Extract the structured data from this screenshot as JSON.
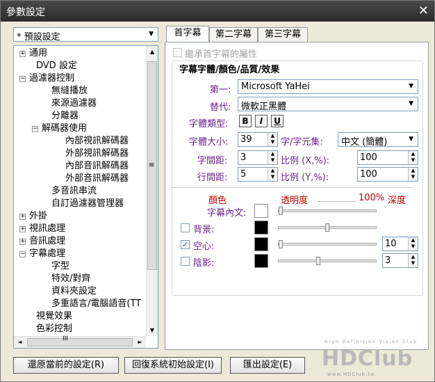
{
  "window": {
    "title": "參數設定",
    "close_glyph": "✕"
  },
  "preset": {
    "value": "* 預設設定"
  },
  "tree": [
    {
      "label": "通用",
      "expander": "+"
    },
    {
      "label": "DVD 設定",
      "expander": ""
    },
    {
      "label": "過濾器控制",
      "expander": "−"
    },
    {
      "label": "無縫播放",
      "expander": ""
    },
    {
      "label": "來源過濾器",
      "expander": ""
    },
    {
      "label": "分離器",
      "expander": ""
    },
    {
      "label": "解碼器使用",
      "expander": "−"
    },
    {
      "label": "內部視訊解碼器",
      "expander": ""
    },
    {
      "label": "外部視訊解碼器",
      "expander": ""
    },
    {
      "label": "內部音訊解碼器",
      "expander": ""
    },
    {
      "label": "外部音訊解碼器",
      "expander": ""
    },
    {
      "label": "多音訊串流",
      "expander": ""
    },
    {
      "label": "自訂過濾器管理器",
      "expander": ""
    },
    {
      "label": "外掛",
      "expander": "+"
    },
    {
      "label": "視訊處理",
      "expander": "+"
    },
    {
      "label": "音訊處理",
      "expander": "+"
    },
    {
      "label": "字幕處理",
      "expander": "−"
    },
    {
      "label": "字型",
      "expander": ""
    },
    {
      "label": "特效/對齊",
      "expander": ""
    },
    {
      "label": "資料夾設定",
      "expander": ""
    },
    {
      "label": "多重語言/電腦語音(TT",
      "expander": ""
    },
    {
      "label": "視覺效果",
      "expander": ""
    },
    {
      "label": "色彩控制",
      "expander": ""
    }
  ],
  "tabs": [
    "首字幕",
    "第二字幕",
    "第三字幕"
  ],
  "inherit": {
    "label": "繼承首字幕的屬性"
  },
  "group_title": "字幕字體/顏色/品質/效果",
  "fields": {
    "primary_label": "第一:",
    "primary_value": "Microsoft YaHei",
    "alternate_label": "替代:",
    "alternate_value": "微軟正黑體",
    "style_label": "字體類型:",
    "style_buttons": [
      "B",
      "I",
      "U"
    ],
    "size_label": "字體大小:",
    "size_value": "39",
    "charset_label": "字/字元集:",
    "charset_value": "中文 (簡體)",
    "spacing_label": "字間距:",
    "spacing_value": "3",
    "scale_x_label": "比例 (X,%):",
    "scale_x_value": "100",
    "linespacing_label": "行間距:",
    "linespacing_value": "5",
    "scale_y_label": "比例 (Y,%):",
    "scale_y_value": "100"
  },
  "colors": {
    "header_color": "顏色",
    "header_opacity": "透明度",
    "header_percent": "100%",
    "header_depth": "深度",
    "rows": [
      {
        "label": "字幕內文:",
        "has_checkbox": false,
        "checked": false,
        "swatch": "#ffffff",
        "opacity": 0.0,
        "depth": ""
      },
      {
        "label": "背景:",
        "has_checkbox": true,
        "checked": false,
        "swatch": "#000000",
        "opacity": 0.5,
        "depth": ""
      },
      {
        "label": "空心:",
        "has_checkbox": true,
        "checked": true,
        "swatch": "#000000",
        "opacity": 0.0,
        "depth": "10"
      },
      {
        "label": "陰影:",
        "has_checkbox": true,
        "checked": false,
        "swatch": "#000000",
        "opacity": 0.4,
        "depth": "3"
      }
    ]
  },
  "buttons": {
    "restore_current": "還原當前的設定(R)",
    "restore_default": "回復系統初始設定(I)",
    "export": "匯出設定(E)"
  },
  "watermark": {
    "brand": "HDClub",
    "tagline": "High Definition Vision Club",
    "url": "www.HDClub.tw"
  }
}
